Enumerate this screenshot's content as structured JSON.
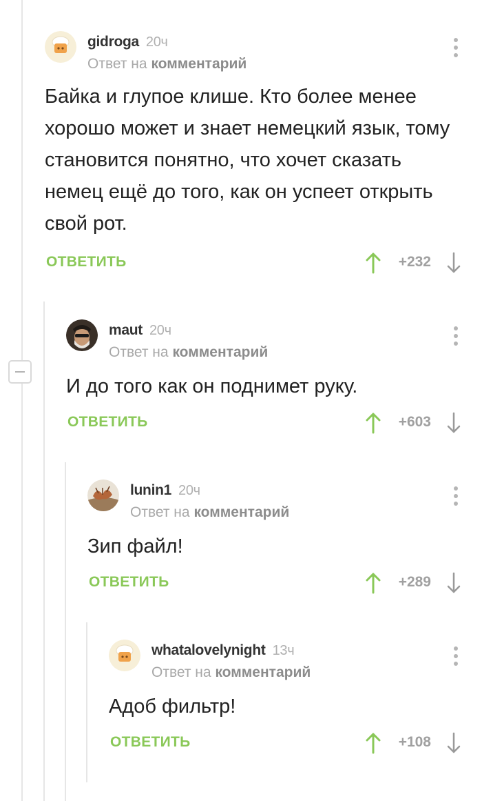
{
  "comments": [
    {
      "username": "gidroga",
      "time": "20ч",
      "reply_prefix": "Ответ на",
      "reply_target": "комментарий",
      "text": "Байка и глупое клише. Кто более менее хорошо может и знает немецкий язык, тому становится понятно, что хочет сказать немец ещё до того, как он успеет открыть свой рот.",
      "reply_label": "ОТВЕТИТЬ",
      "rating": "+232",
      "avatar_icon": "chef-hat-avatar"
    },
    {
      "username": "maut",
      "time": "20ч",
      "reply_prefix": "Ответ на",
      "reply_target": "комментарий",
      "text": "И до того как он поднимет руку.",
      "reply_label": "ОТВЕТИТЬ",
      "rating": "+603",
      "avatar_icon": "bearded-man-avatar"
    },
    {
      "username": "lunin1",
      "time": "20ч",
      "reply_prefix": "Ответ на",
      "reply_target": "комментарий",
      "text": "Зип файл!",
      "reply_label": "ОТВЕТИТЬ",
      "rating": "+289",
      "avatar_icon": "photo-avatar"
    },
    {
      "username": "whatalovelynight",
      "time": "13ч",
      "reply_prefix": "Ответ на",
      "reply_target": "комментарий",
      "text": "Адоб фильтр!",
      "reply_label": "ОТВЕТИТЬ",
      "rating": "+108",
      "avatar_icon": "chef-hat-avatar"
    }
  ],
  "colors": {
    "accent_green": "#8ac858",
    "thread_line": "#e6e6e6",
    "muted_text": "#a8a8a8"
  }
}
